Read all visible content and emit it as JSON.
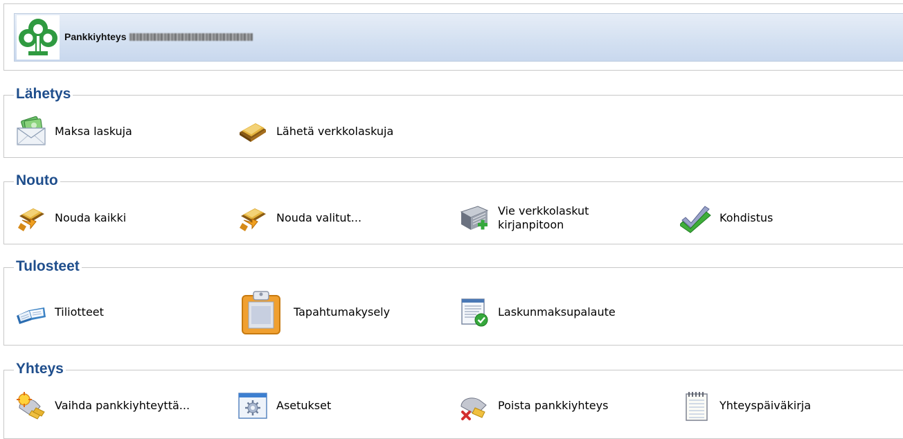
{
  "header": {
    "title": "Pankkiyhteys",
    "logo": "tree-logo-icon",
    "logo_color": "#2f9a40"
  },
  "sections": [
    {
      "title": "Lähetys",
      "items": [
        {
          "label": "Maksa laskuja",
          "icon": "envelope-money-icon"
        },
        {
          "label": "Lähetä verkkolaskuja",
          "icon": "gold-wallet-icon"
        }
      ]
    },
    {
      "title": "Nouto",
      "items": [
        {
          "label": "Nouda kaikki",
          "icon": "download-wallet-icon"
        },
        {
          "label": "Nouda valitut...",
          "icon": "download-wallet-icon"
        },
        {
          "label": "Vie verkkolaskut kirjanpitoon",
          "icon": "book-add-icon"
        },
        {
          "label": "Kohdistus",
          "icon": "double-check-icon"
        }
      ]
    },
    {
      "title": "Tulosteet",
      "items": [
        {
          "label": "Tiliotteet",
          "icon": "open-book-icon"
        },
        {
          "label": "Tapahtumakysely",
          "icon": "clipboard-icon"
        },
        {
          "label": "Laskunmaksupalaute",
          "icon": "document-check-icon"
        }
      ]
    },
    {
      "title": "Yhteys",
      "items": [
        {
          "label": "Vaihda pankkiyhteyttä...",
          "icon": "connection-switch-icon"
        },
        {
          "label": "Asetukset",
          "icon": "settings-window-icon"
        },
        {
          "label": "Poista pankkiyhteys",
          "icon": "connection-remove-icon"
        },
        {
          "label": "Yhteyspäiväkirja",
          "icon": "notepad-icon"
        }
      ]
    }
  ],
  "colors": {
    "section_title": "#1f4e8c",
    "banner_gradient_top": "#e6edf7",
    "banner_gradient_bottom": "#c9d8ee"
  }
}
